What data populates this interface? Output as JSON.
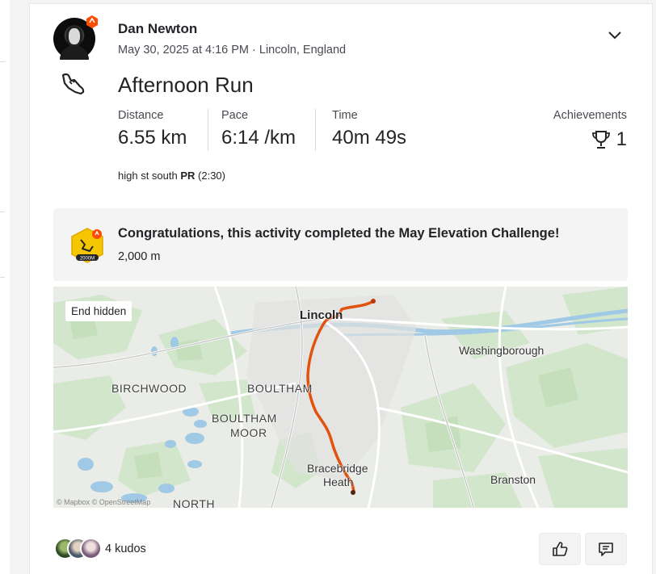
{
  "activity": {
    "athlete_name": "Dan Newton",
    "meta": "May 30, 2025 at 4:16 PM · Lincoln, England",
    "title": "Afternoon Run",
    "stats": [
      {
        "label": "Distance",
        "value": "6.55 km"
      },
      {
        "label": "Pace",
        "value": "6:14 /km"
      },
      {
        "label": "Time",
        "value": "40m 49s"
      }
    ],
    "achievements": {
      "label": "Achievements",
      "count": "1"
    },
    "segment": {
      "name": "high st south",
      "pr_label": "PR",
      "pr_time": "(2:30)"
    }
  },
  "challenge": {
    "text": "Congratulations, this activity completed the May Elevation Challenge!",
    "sub": "2,000 m",
    "badge_text": "2000M"
  },
  "map": {
    "end_hidden": "End hidden",
    "labels": {
      "lincoln": "Lincoln",
      "washingborough": "Washingborough",
      "birchwood": "BIRCHWOOD",
      "boultham": "BOULTHAM",
      "boultham_moor_1": "BOULTHAM",
      "boultham_moor_2": "MOOR",
      "bracebridge_1": "Bracebridge",
      "bracebridge_2": "Heath",
      "branston": "Branston",
      "north": "NORTH"
    },
    "attribution": "© Mapbox © OpenStreetMap"
  },
  "kudos": {
    "text": "4 kudos"
  },
  "colors": {
    "route": "#e2520f",
    "accent": "#fc4c02"
  },
  "icons": [
    "chevron-down-icon",
    "shoe-icon",
    "trophy-icon",
    "thumbs-up-icon",
    "comment-icon"
  ]
}
